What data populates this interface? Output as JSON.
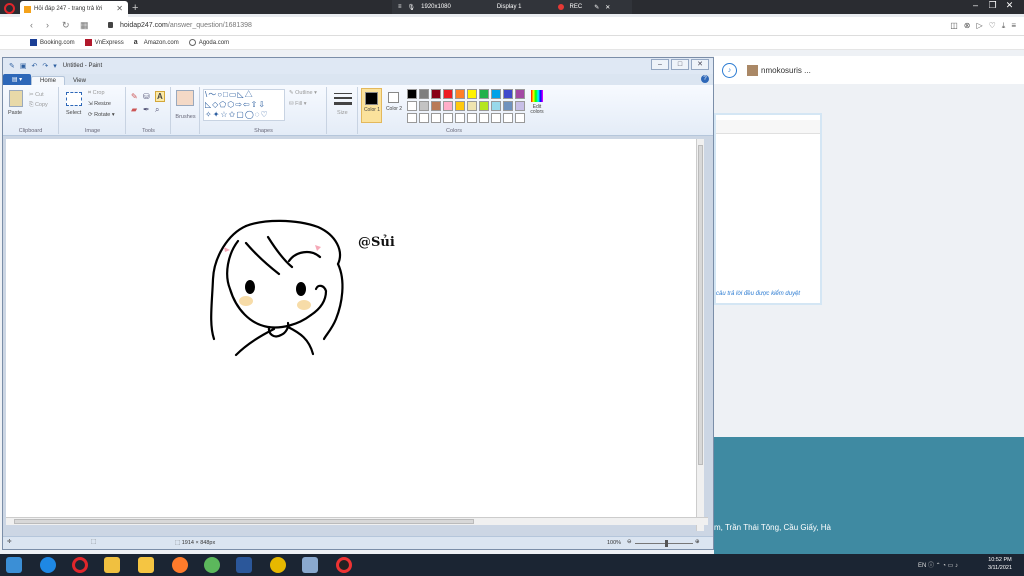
{
  "recording": {
    "resolution": "1920x1080",
    "display": "Display 1",
    "rec_label": "REC"
  },
  "browser": {
    "tab_title": "Hỏi đáp 247 - trang trả lời",
    "url_host": "hoidap247.com",
    "url_path": "/answer_question/1681398",
    "bookmarks": [
      "Booking.com",
      "VnExpress",
      "Amazon.com",
      "Agoda.com"
    ]
  },
  "site": {
    "username": "nmokosuris ...",
    "card_note": "câu trả lời đều được kiểm duyệt",
    "footer_text": "m, Trần Thái Tông, Cầu Giấy, Hà"
  },
  "paint": {
    "title": "Untitled - Paint",
    "tabs": [
      "Home",
      "View"
    ],
    "groups": {
      "clipboard": {
        "label": "Clipboard",
        "paste": "Paste",
        "cut": "Cut",
        "copy": "Copy"
      },
      "image": {
        "label": "Image",
        "select": "Select",
        "crop": "Crop",
        "resize": "Resize",
        "rotate": "Rotate"
      },
      "tools": {
        "label": "Tools"
      },
      "brushes": {
        "label": "Brushes"
      },
      "shapes": {
        "label": "Shapes",
        "outline": "Outline",
        "fill": "Fill"
      },
      "size": {
        "label": "Size"
      },
      "colors": {
        "label": "Colors",
        "color1": "Color 1",
        "color2": "Color 2",
        "edit": "Edit colors"
      }
    },
    "palette": [
      "#000000",
      "#7f7f7f",
      "#880015",
      "#ed1c24",
      "#ff7f27",
      "#fff200",
      "#22b14c",
      "#00a2e8",
      "#3f48cc",
      "#a349a4",
      "#ffffff",
      "#c3c3c3",
      "#b97a57",
      "#ffaec9",
      "#ffc90e",
      "#efe4b0",
      "#b5e61d",
      "#99d9ea",
      "#7092be",
      "#c8bfe7",
      "#ffffff",
      "#ffffff",
      "#ffffff",
      "#ffffff",
      "#ffffff",
      "#ffffff",
      "#ffffff",
      "#ffffff",
      "#ffffff",
      "#ffffff"
    ],
    "canvas_text": "@Sủi",
    "status_dims": "1914 × 848px",
    "zoom": "100%"
  },
  "taskbar": {
    "lang": "EN",
    "time": "10:52 PM",
    "date": "3/11/2021"
  }
}
